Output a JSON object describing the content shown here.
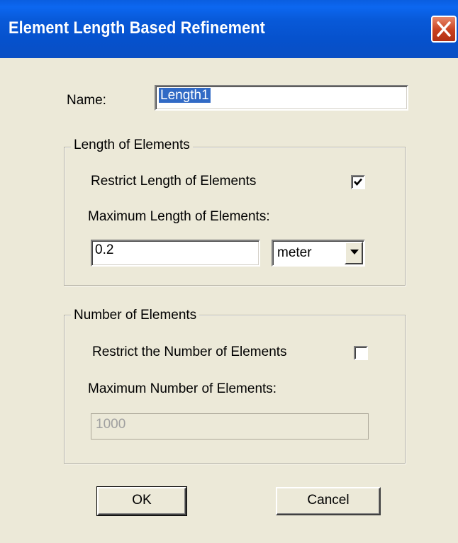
{
  "window": {
    "title": "Element Length Based Refinement",
    "titlebar_color": "#0a5ee0",
    "close_icon": "close-icon"
  },
  "name_field": {
    "label": "Name:",
    "value": "Length1"
  },
  "length_group": {
    "legend": "Length of Elements",
    "restrict_label": "Restrict Length of Elements",
    "restrict_checked": true,
    "max_label": "Maximum Length of Elements:",
    "max_value": "0.2",
    "unit_selected": "meter"
  },
  "number_group": {
    "legend": "Number of Elements",
    "restrict_label": "Restrict the Number of Elements",
    "restrict_checked": false,
    "max_label": "Maximum Number of  Elements:",
    "max_value": "1000"
  },
  "buttons": {
    "ok": "OK",
    "cancel": "Cancel"
  }
}
